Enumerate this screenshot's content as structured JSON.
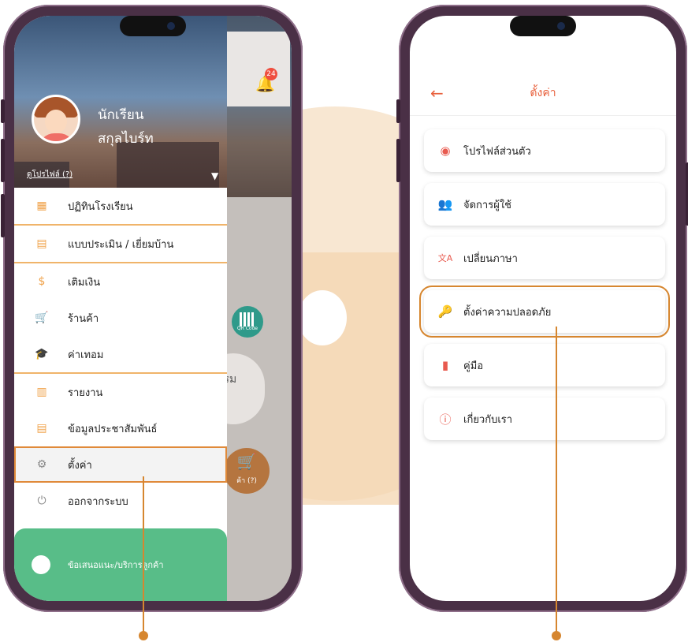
{
  "colors": {
    "accent": "#e8603c",
    "highlight_frame": "#d6862f",
    "menu_separator": "#f0b46a",
    "support_bar": "#58bd88",
    "phone_frame": "#4a3046"
  },
  "left_phone": {
    "notification_count": "24",
    "profile": {
      "role": "นักเรียน",
      "name": "สกุลไบร์ท",
      "view_profile_link": "ดูโปรไฟล์ (?)"
    },
    "background_cards": {
      "qr_label": "QR Code",
      "activity_partial": "รรม",
      "shop_label": "ค้า (?)"
    },
    "menu": [
      {
        "icon": "calendar-icon",
        "glyph": "▦",
        "label": "ปฏิทินโรงเรียน"
      },
      {
        "icon": "assessment-icon",
        "glyph": "▤",
        "label": "แบบประเมิน / เยี่ยมบ้าน"
      },
      {
        "icon": "dollar-icon",
        "glyph": "$",
        "label": "เติมเงิน"
      },
      {
        "icon": "cart-icon",
        "glyph": "🛒",
        "label": "ร้านค้า"
      },
      {
        "icon": "graduation-icon",
        "glyph": "🎓",
        "label": "ค่าเทอม"
      },
      {
        "icon": "chart-icon",
        "glyph": "▥",
        "label": "รายงาน"
      },
      {
        "icon": "news-icon",
        "glyph": "▤",
        "label": "ข้อมูลประชาสัมพันธ์"
      },
      {
        "icon": "gear-icon",
        "glyph": "⚙",
        "label": "ตั้งค่า"
      },
      {
        "icon": "power-icon",
        "glyph": "⏻",
        "label": "ออกจากระบบ"
      }
    ],
    "support_label": "ข้อเสนอแนะ/บริการลูกค้า"
  },
  "right_phone": {
    "title": "ตั้งค่า",
    "back_icon": "arrow-left-icon",
    "items": [
      {
        "icon": "profile-icon",
        "glyph": "◉",
        "label": "โปรไฟล์ส่วนตัว"
      },
      {
        "icon": "users-icon",
        "glyph": "👥",
        "label": "จัดการผู้ใช้"
      },
      {
        "icon": "translate-icon",
        "glyph": "文A",
        "label": "เปลี่ยนภาษา"
      },
      {
        "icon": "key-icon",
        "glyph": "🔑",
        "label": "ตั้งค่าความปลอดภัย"
      },
      {
        "icon": "book-icon",
        "glyph": "▮",
        "label": "คู่มือ"
      },
      {
        "icon": "info-icon",
        "glyph": "ⓘ",
        "label": "เกี่ยวกับเรา"
      }
    ]
  }
}
